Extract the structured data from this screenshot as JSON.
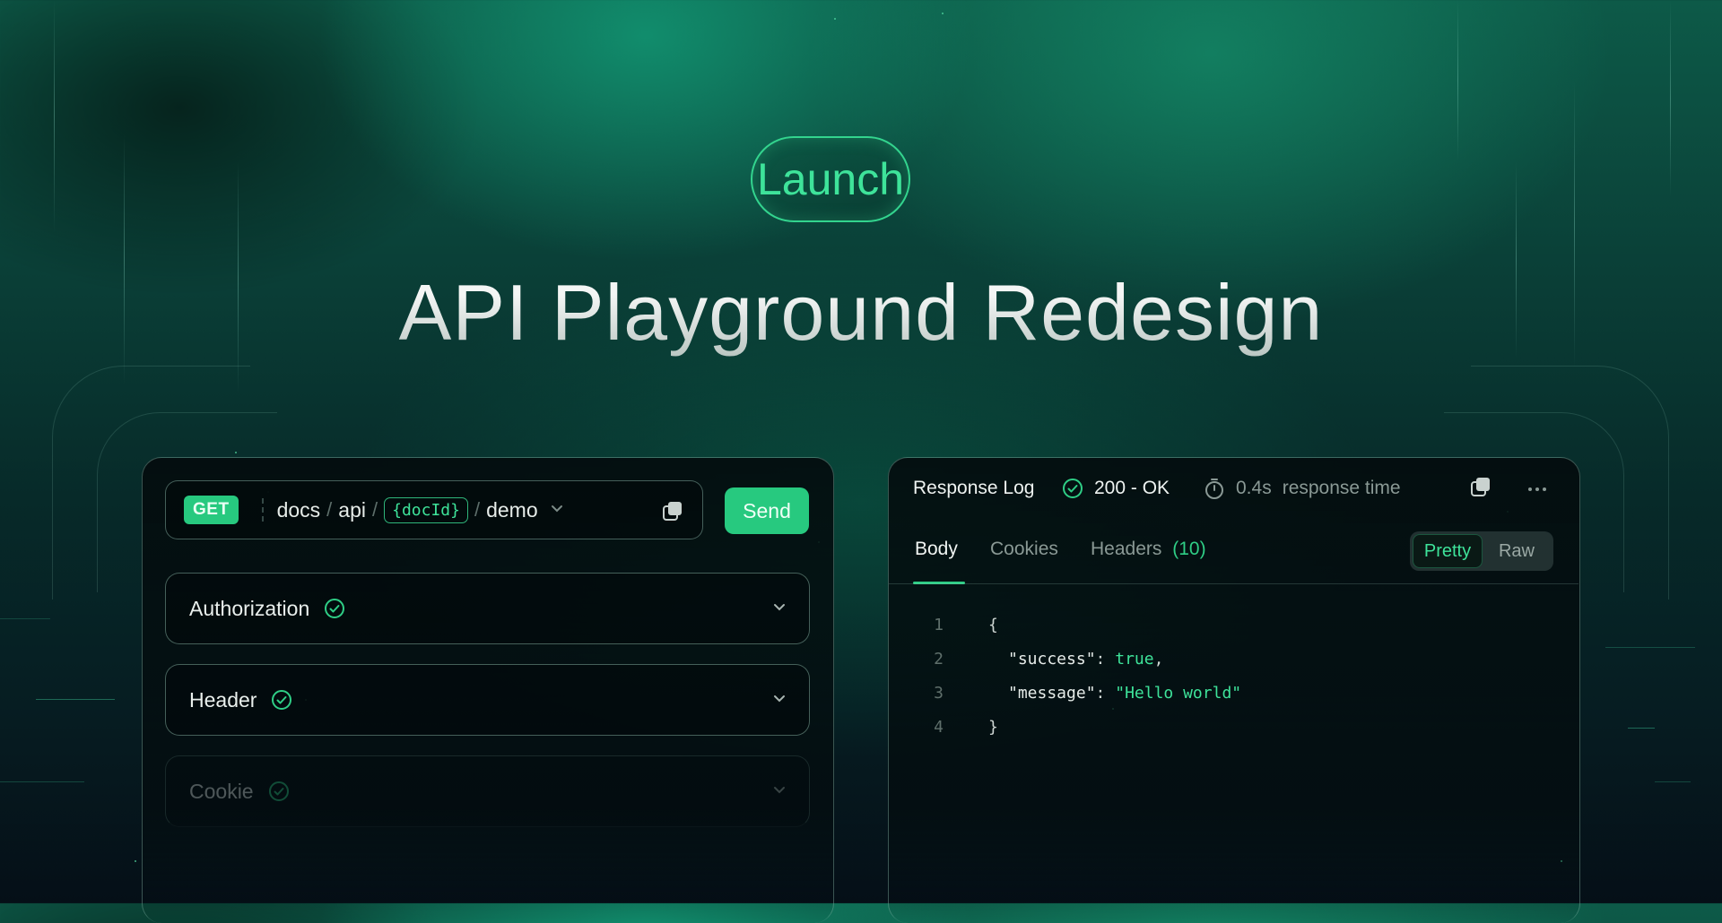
{
  "hero": {
    "badge": "Launch",
    "title": "API Playground Redesign"
  },
  "request": {
    "method": "GET",
    "path_segments": [
      "docs",
      "api"
    ],
    "path_param": "{docId}",
    "path_tail": "demo",
    "send_label": "Send",
    "sections": [
      {
        "label": "Authorization",
        "status": "check"
      },
      {
        "label": "Header",
        "status": "check"
      },
      {
        "label": "Cookie",
        "status": "check"
      }
    ]
  },
  "response": {
    "title": "Response Log",
    "status_text": "200 - OK",
    "time_value": "0.4s",
    "time_label": "response time",
    "tabs": [
      {
        "label": "Body",
        "active": true
      },
      {
        "label": "Cookies",
        "active": false
      },
      {
        "label": "Headers",
        "count": "(10)",
        "active": false
      }
    ],
    "view_modes": {
      "pretty": "Pretty",
      "raw": "Raw",
      "selected": "Pretty"
    },
    "code_lines": [
      {
        "num": "1",
        "text": "{"
      },
      {
        "num": "2",
        "key": "\"success\"",
        "value": "true",
        "trail": ","
      },
      {
        "num": "3",
        "key": "\"message\"",
        "value": "\"Hello world\"",
        "trail": ""
      },
      {
        "num": "4",
        "text": "}"
      }
    ]
  },
  "colors": {
    "accent": "#27c97f",
    "accent_text": "#3ee39a",
    "background_top": "#0d5a48",
    "background_bottom": "#050f17"
  },
  "icons": [
    "check-circle-icon",
    "copy-icon",
    "chevron-down-icon",
    "stopwatch-icon",
    "more-icon"
  ]
}
